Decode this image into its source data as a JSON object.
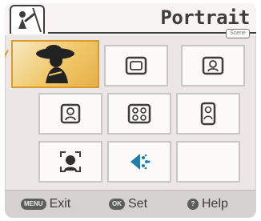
{
  "header": {
    "title": "Portrait",
    "scene_tag": "Scene",
    "tab_icon": "scene-mode-icon"
  },
  "scene_grid": {
    "selected": "portrait",
    "items": [
      {
        "id": "portrait",
        "icon": "portrait-hat-icon"
      },
      {
        "id": "landscape",
        "icon": "landscape-frame-icon"
      },
      {
        "id": "portrait-frame",
        "icon": "portrait-frame-icon"
      },
      {
        "id": "night-portrait",
        "icon": "person-frame-icon"
      },
      {
        "id": "group",
        "icon": "group-frame-icon"
      },
      {
        "id": "tall-person",
        "icon": "tall-person-icon"
      },
      {
        "id": "face",
        "icon": "face-detect-icon"
      },
      {
        "id": "fireworks",
        "icon": "fireworks-icon"
      },
      {
        "id": "empty",
        "icon": ""
      }
    ]
  },
  "footer": {
    "exit": {
      "key": "MENU",
      "label": "Exit"
    },
    "set": {
      "key": "OK",
      "label": "Set"
    },
    "help": {
      "key": "?",
      "label": "Help"
    }
  },
  "colors": {
    "accent": "#e7b04a",
    "text": "#3d3d3d",
    "icon_blue": "#1f7fa8"
  }
}
